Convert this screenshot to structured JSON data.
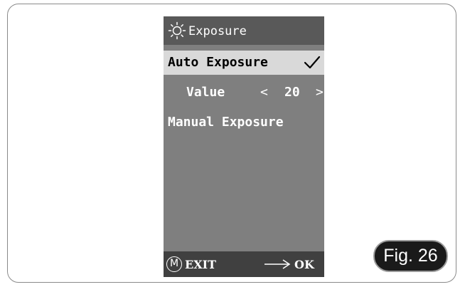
{
  "screen": {
    "header": {
      "icon": "sun-icon",
      "title": "Exposure"
    },
    "menu": {
      "auto_exposure": {
        "label": "Auto Exposure",
        "selected": true,
        "checked": true,
        "check_icon": "checkmark-icon"
      },
      "value": {
        "label": "Value",
        "left_chevron": "<",
        "number": "20",
        "right_chevron": ">"
      },
      "manual_exposure": {
        "label": "Manual Exposure"
      }
    },
    "footer": {
      "m_icon_glyph": "M",
      "exit_label": "EXIT",
      "arrow_icon": "right-arrow-icon",
      "ok_label": "OK"
    }
  },
  "figure_label": "Fig. 26",
  "colors": {
    "screen_bg": "#7f7f7f",
    "header_bg": "#595959",
    "selected_bg": "#d9d9d9",
    "footer_bg": "#404040",
    "badge_bg": "#1a1a1a"
  }
}
